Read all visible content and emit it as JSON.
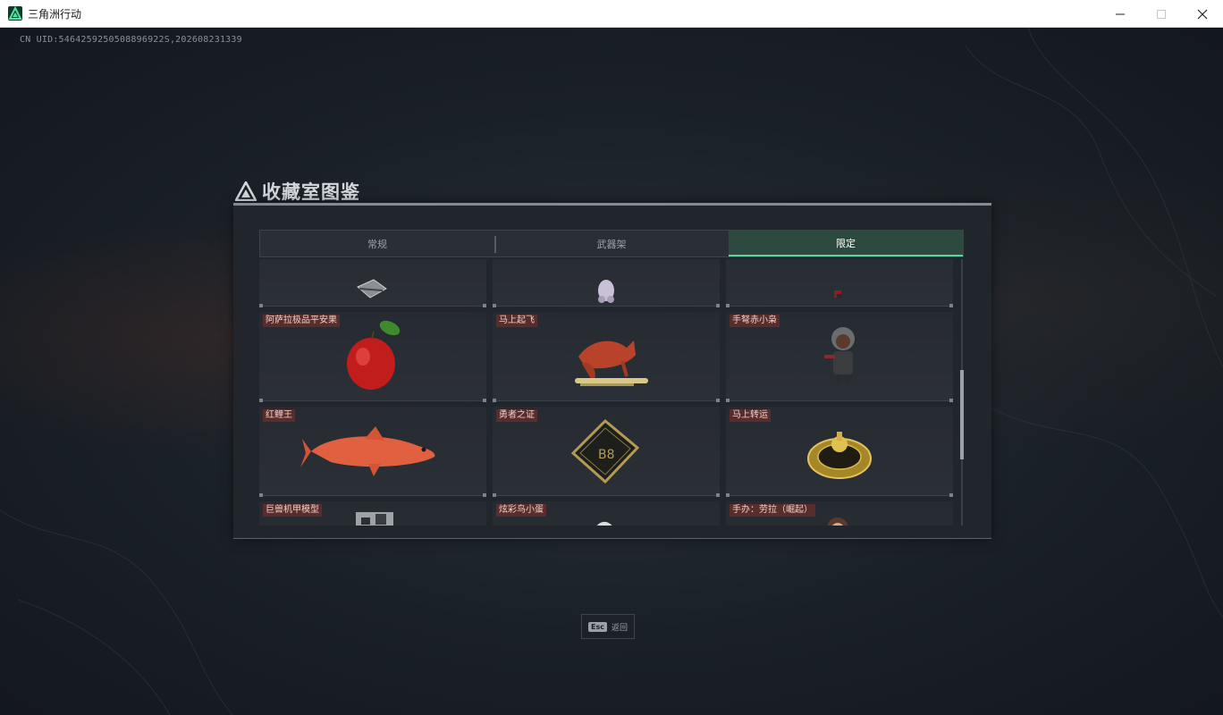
{
  "window": {
    "title": "三角洲行动",
    "controls": [
      "minimize",
      "maximize",
      "close"
    ]
  },
  "game": {
    "uid_text": "CN UID:5464259250508896922S,202608231339"
  },
  "panel": {
    "title": "收藏室图鉴",
    "tabs": [
      {
        "label": "常规",
        "active": false
      },
      {
        "label": "武器架",
        "active": false
      },
      {
        "label": "限定",
        "active": true
      }
    ],
    "items": [
      {
        "label": "",
        "icon": "keychain-icon"
      },
      {
        "label": "",
        "icon": "figure-icon"
      },
      {
        "label": "",
        "icon": "figure-small-icon"
      },
      {
        "label": "阿萨拉极品平安果",
        "icon": "apple-icon"
      },
      {
        "label": "马上起飞",
        "icon": "horse-statue-icon"
      },
      {
        "label": "手弩赤小枭",
        "icon": "hooded-figure-icon"
      },
      {
        "label": "红鲤王",
        "icon": "koi-fish-icon"
      },
      {
        "label": "勇者之证",
        "icon": "gold-card-icon"
      },
      {
        "label": "马上转运",
        "icon": "golden-wheel-icon"
      },
      {
        "label": "巨兽机甲模型",
        "icon": "mech-model-icon"
      },
      {
        "label": "炫彩鸟小蛋",
        "icon": "bird-egg-icon"
      },
      {
        "label": "手办：劳拉（崛起）",
        "icon": "lara-figure-icon"
      }
    ]
  },
  "footer": {
    "esc_key": "Esc",
    "esc_label": "返回"
  },
  "colors": {
    "accent": "#5fd5a0",
    "label_bg": "#5a2d2d",
    "active_tab_bg": "#2d4a40"
  }
}
